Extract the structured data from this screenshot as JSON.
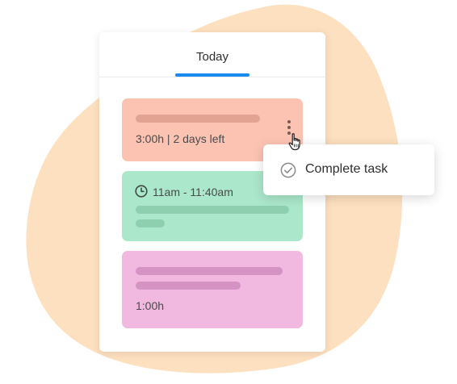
{
  "panel": {
    "tab_label": "Today"
  },
  "tasks": [
    {
      "meta": "3:00h | 2 days left",
      "color": "#fcc3b2"
    },
    {
      "time": "11am - 11:40am",
      "color": "#abe7cb"
    },
    {
      "meta": "1:00h",
      "color": "#f1b9e0"
    }
  ],
  "popup": {
    "action_label": "Complete task"
  },
  "icons": [
    "more-vertical-icon",
    "clock-icon",
    "hand-cursor-icon",
    "check-circle-icon"
  ],
  "colors": {
    "accent": "#1a8cf0",
    "blob": "#fde0bf"
  }
}
